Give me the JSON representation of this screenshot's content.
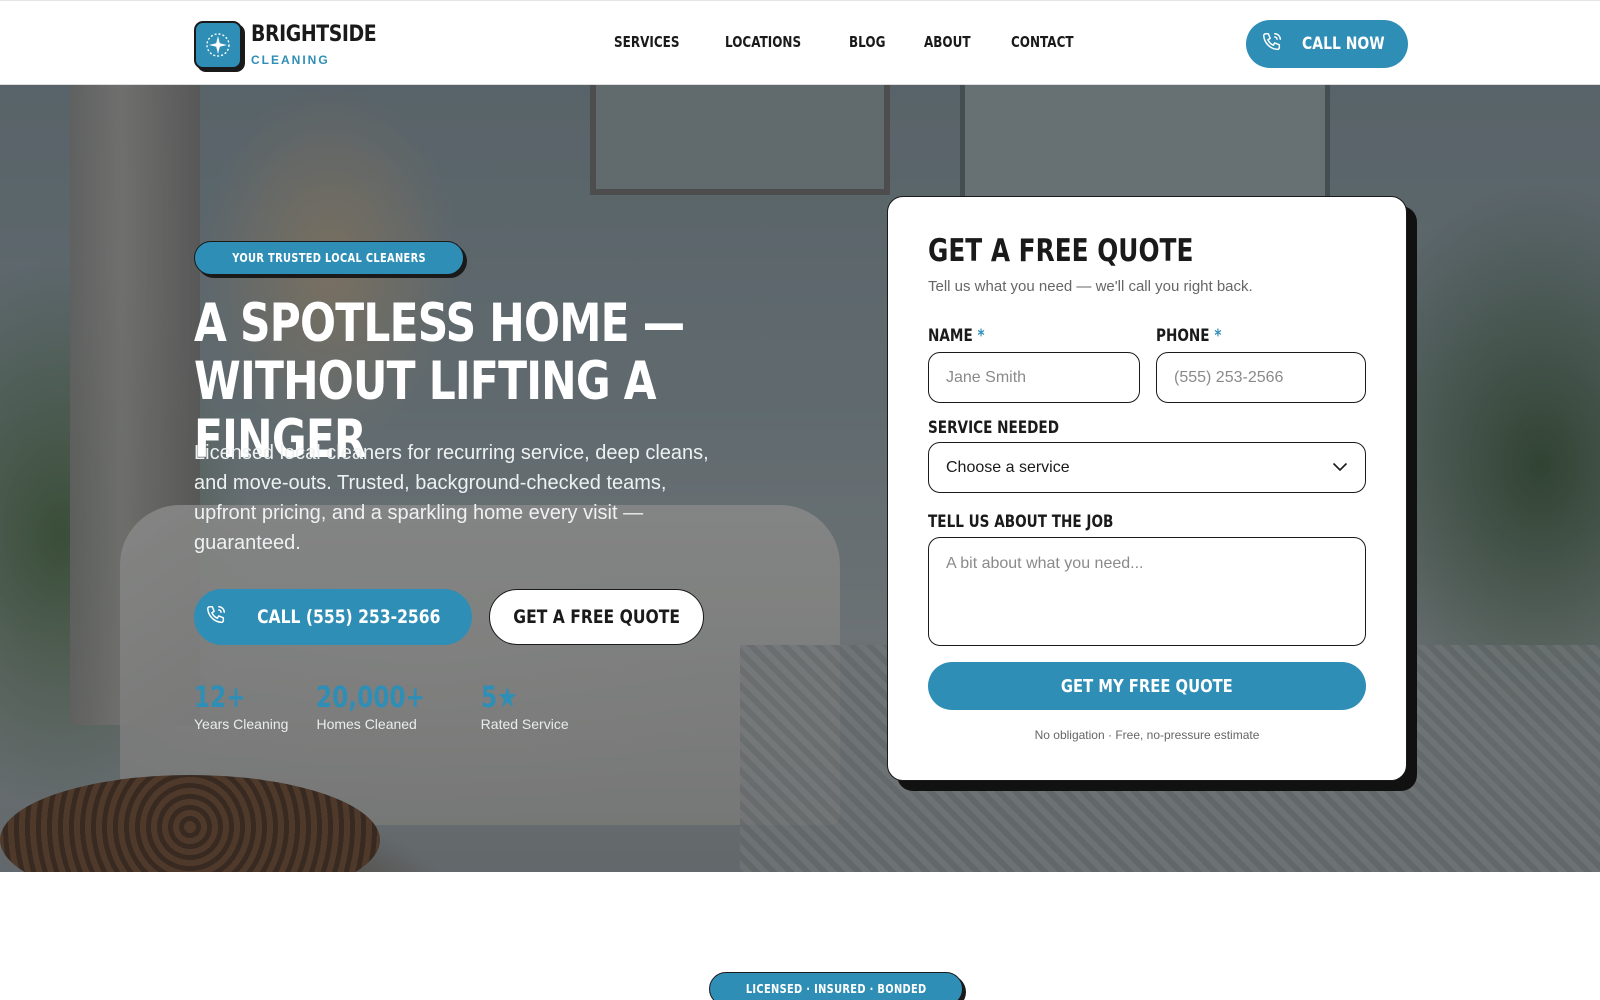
{
  "brand": {
    "name": "BRIGHTSIDE",
    "sub": "CLEANING",
    "icon": "sparkle-icon",
    "accent_color": "#2f8eb5"
  },
  "nav": {
    "items": [
      "SERVICES",
      "LOCATIONS",
      "BLOG",
      "ABOUT",
      "CONTACT"
    ]
  },
  "header": {
    "call_label": "CALL NOW",
    "call_icon": "phone-icon"
  },
  "hero": {
    "badge": "YOUR TRUSTED LOCAL CLEANERS",
    "headline_line1": "A SPOTLESS HOME —",
    "headline_line2": "WITHOUT LIFTING A FINGER",
    "lead": "Licensed local cleaners for recurring service, deep cleans, and move-outs. Trusted, background-checked teams, upfront pricing, and a sparkling home every visit — guaranteed.",
    "call_button": "CALL (555) 253-2566",
    "quote_button": "GET A FREE QUOTE",
    "stats": [
      {
        "value": "12+",
        "label": "Years Cleaning"
      },
      {
        "value": "20,000+",
        "label": "Homes Cleaned"
      },
      {
        "value": "5★",
        "label": "Rated Service"
      }
    ]
  },
  "quote_form": {
    "title": "GET A FREE QUOTE",
    "subtitle": "Tell us what you need — we'll call you right back.",
    "name_label": "NAME",
    "name_placeholder": "Jane Smith",
    "phone_label": "PHONE",
    "phone_placeholder": "(555) 253-2566",
    "required_mark": "*",
    "service_label": "SERVICE NEEDED",
    "service_value": "Choose a service",
    "job_label": "TELL US ABOUT THE JOB",
    "job_placeholder": "A bit about what you need...",
    "submit": "GET MY FREE QUOTE",
    "fine_print": "No obligation · Free, no-pressure estimate"
  },
  "next_section": {
    "badge": "LICENSED · INSURED · BONDED"
  }
}
